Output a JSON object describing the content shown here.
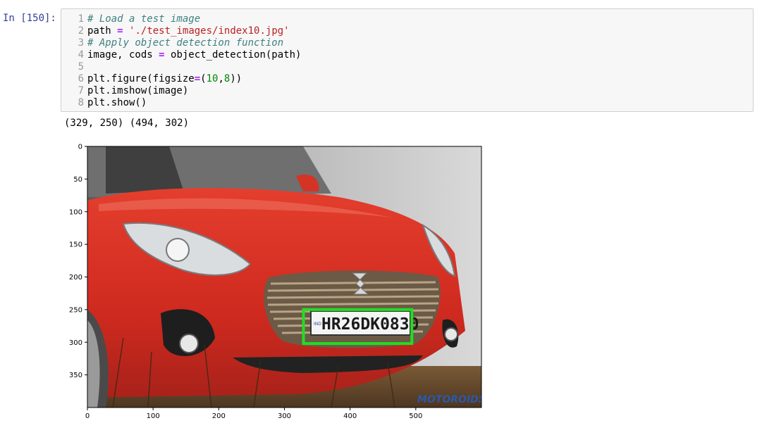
{
  "cell": {
    "prompt": "In [150]:",
    "line_numbers": [
      "1",
      "2",
      "3",
      "4",
      "5",
      "6",
      "7",
      "8"
    ],
    "code": {
      "l1_comment": "# Load a test image",
      "l2_name": "path ",
      "l2_op": "=",
      "l2_sp": " ",
      "l2_string": "'./test_images/index10.jpg'",
      "l3_comment": "# Apply object detection function",
      "l4_name": "image, cods ",
      "l4_op": "=",
      "l4_rest": " object_detection(path)",
      "l6_pre": "plt.figure(figsize",
      "l6_op": "=",
      "l6_open": "(",
      "l6_n1": "10",
      "l6_comma": ",",
      "l6_n2": "8",
      "l6_close": "))",
      "l7": "plt.imshow(image)",
      "l8": "plt.show()"
    },
    "output": "(329, 250) (494, 302)"
  },
  "plot": {
    "x_ticks": [
      "0",
      "100",
      "200",
      "300",
      "400",
      "500"
    ],
    "y_ticks": [
      "0",
      "50",
      "100",
      "150",
      "200",
      "250",
      "300",
      "350"
    ],
    "plate_label": "HR26DK0830",
    "plate_country": "IND",
    "watermark": "MOTOROIDS",
    "box_color": "#22dd22"
  },
  "chart_data": {
    "type": "image",
    "xlim": [
      0,
      600
    ],
    "ylim": [
      400,
      0
    ],
    "bounding_box": {
      "x1": 329,
      "y1": 250,
      "x2": 494,
      "y2": 302
    }
  }
}
